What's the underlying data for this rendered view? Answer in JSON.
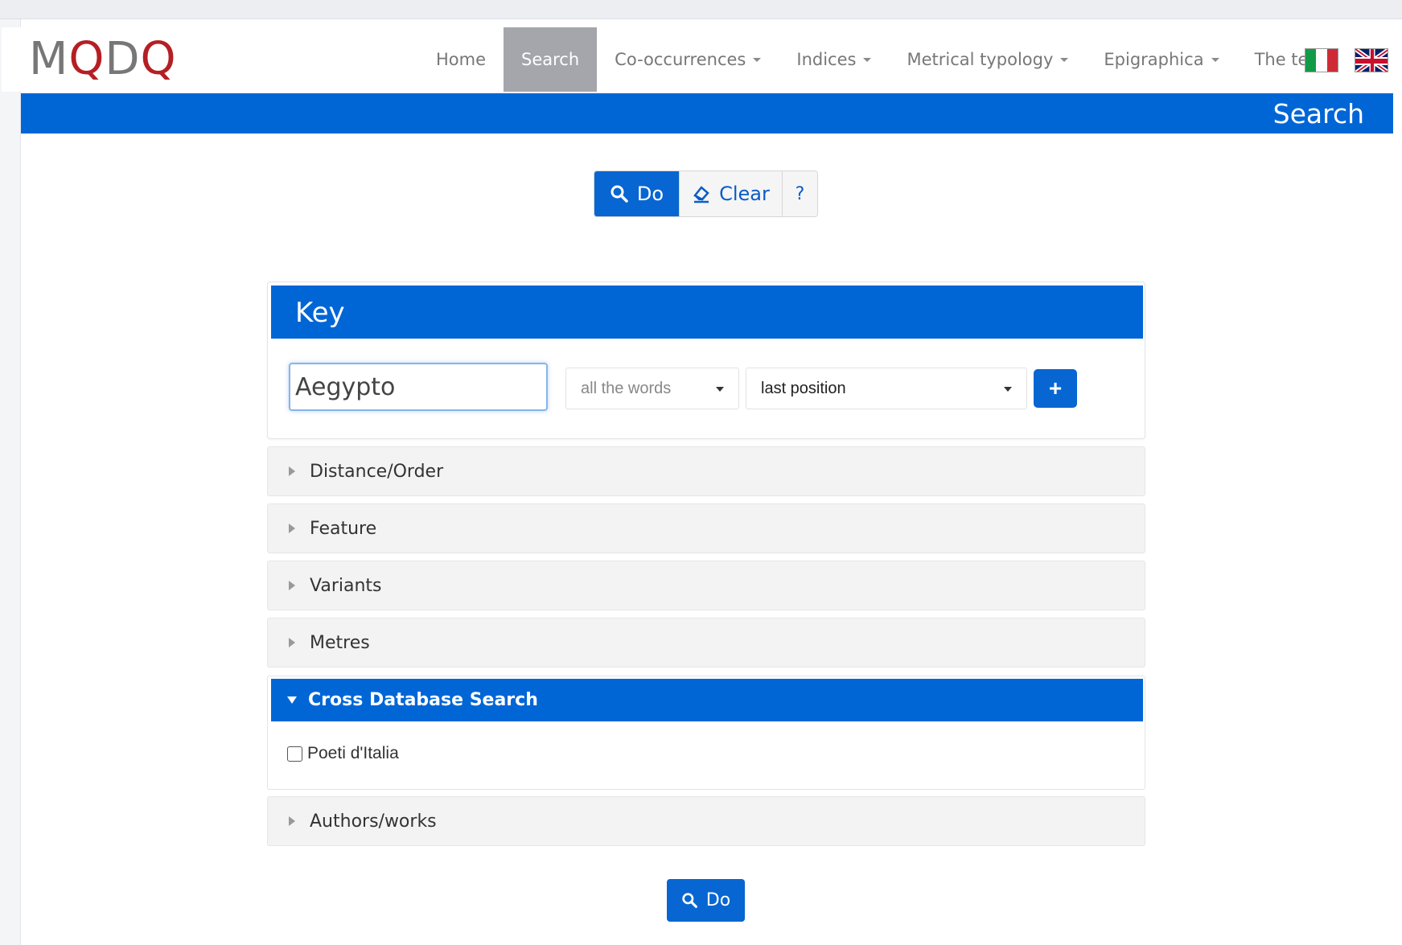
{
  "brand": {
    "text_m": "M",
    "text_q": "Q",
    "text_d": "D",
    "text_q2": "Q"
  },
  "nav": {
    "items": [
      {
        "label": "Home",
        "dropdown": false,
        "active": false
      },
      {
        "label": "Search",
        "dropdown": false,
        "active": true
      },
      {
        "label": "Co-occurrences",
        "dropdown": true,
        "active": false
      },
      {
        "label": "Indices",
        "dropdown": true,
        "active": false
      },
      {
        "label": "Metrical typology",
        "dropdown": true,
        "active": false
      },
      {
        "label": "Epigraphica",
        "dropdown": true,
        "active": false
      },
      {
        "label": "The team",
        "dropdown": false,
        "active": false
      }
    ],
    "flags": [
      "italian-flag-icon",
      "uk-flag-icon"
    ]
  },
  "page_title": "Search",
  "toolbar": {
    "do_label": "Do",
    "clear_label": "Clear",
    "help_label": "?"
  },
  "key_panel": {
    "title": "Key",
    "input_value": "Aegypto",
    "mode_select": "all the words",
    "position_select": "last position",
    "add_label": "+"
  },
  "sections": {
    "distance": "Distance/Order",
    "feature": "Feature",
    "variants": "Variants",
    "metres": "Metres",
    "cross_db": "Cross Database Search",
    "authors": "Authors/works"
  },
  "cross_db": {
    "checkbox_label": "Poeti d'Italia",
    "checked": false
  },
  "bottom": {
    "do_label": "Do"
  },
  "colors": {
    "primary": "#0066d6",
    "brand_red": "#b51f24",
    "brand_gray": "#777777",
    "active_nav": "#a4a6ab"
  }
}
